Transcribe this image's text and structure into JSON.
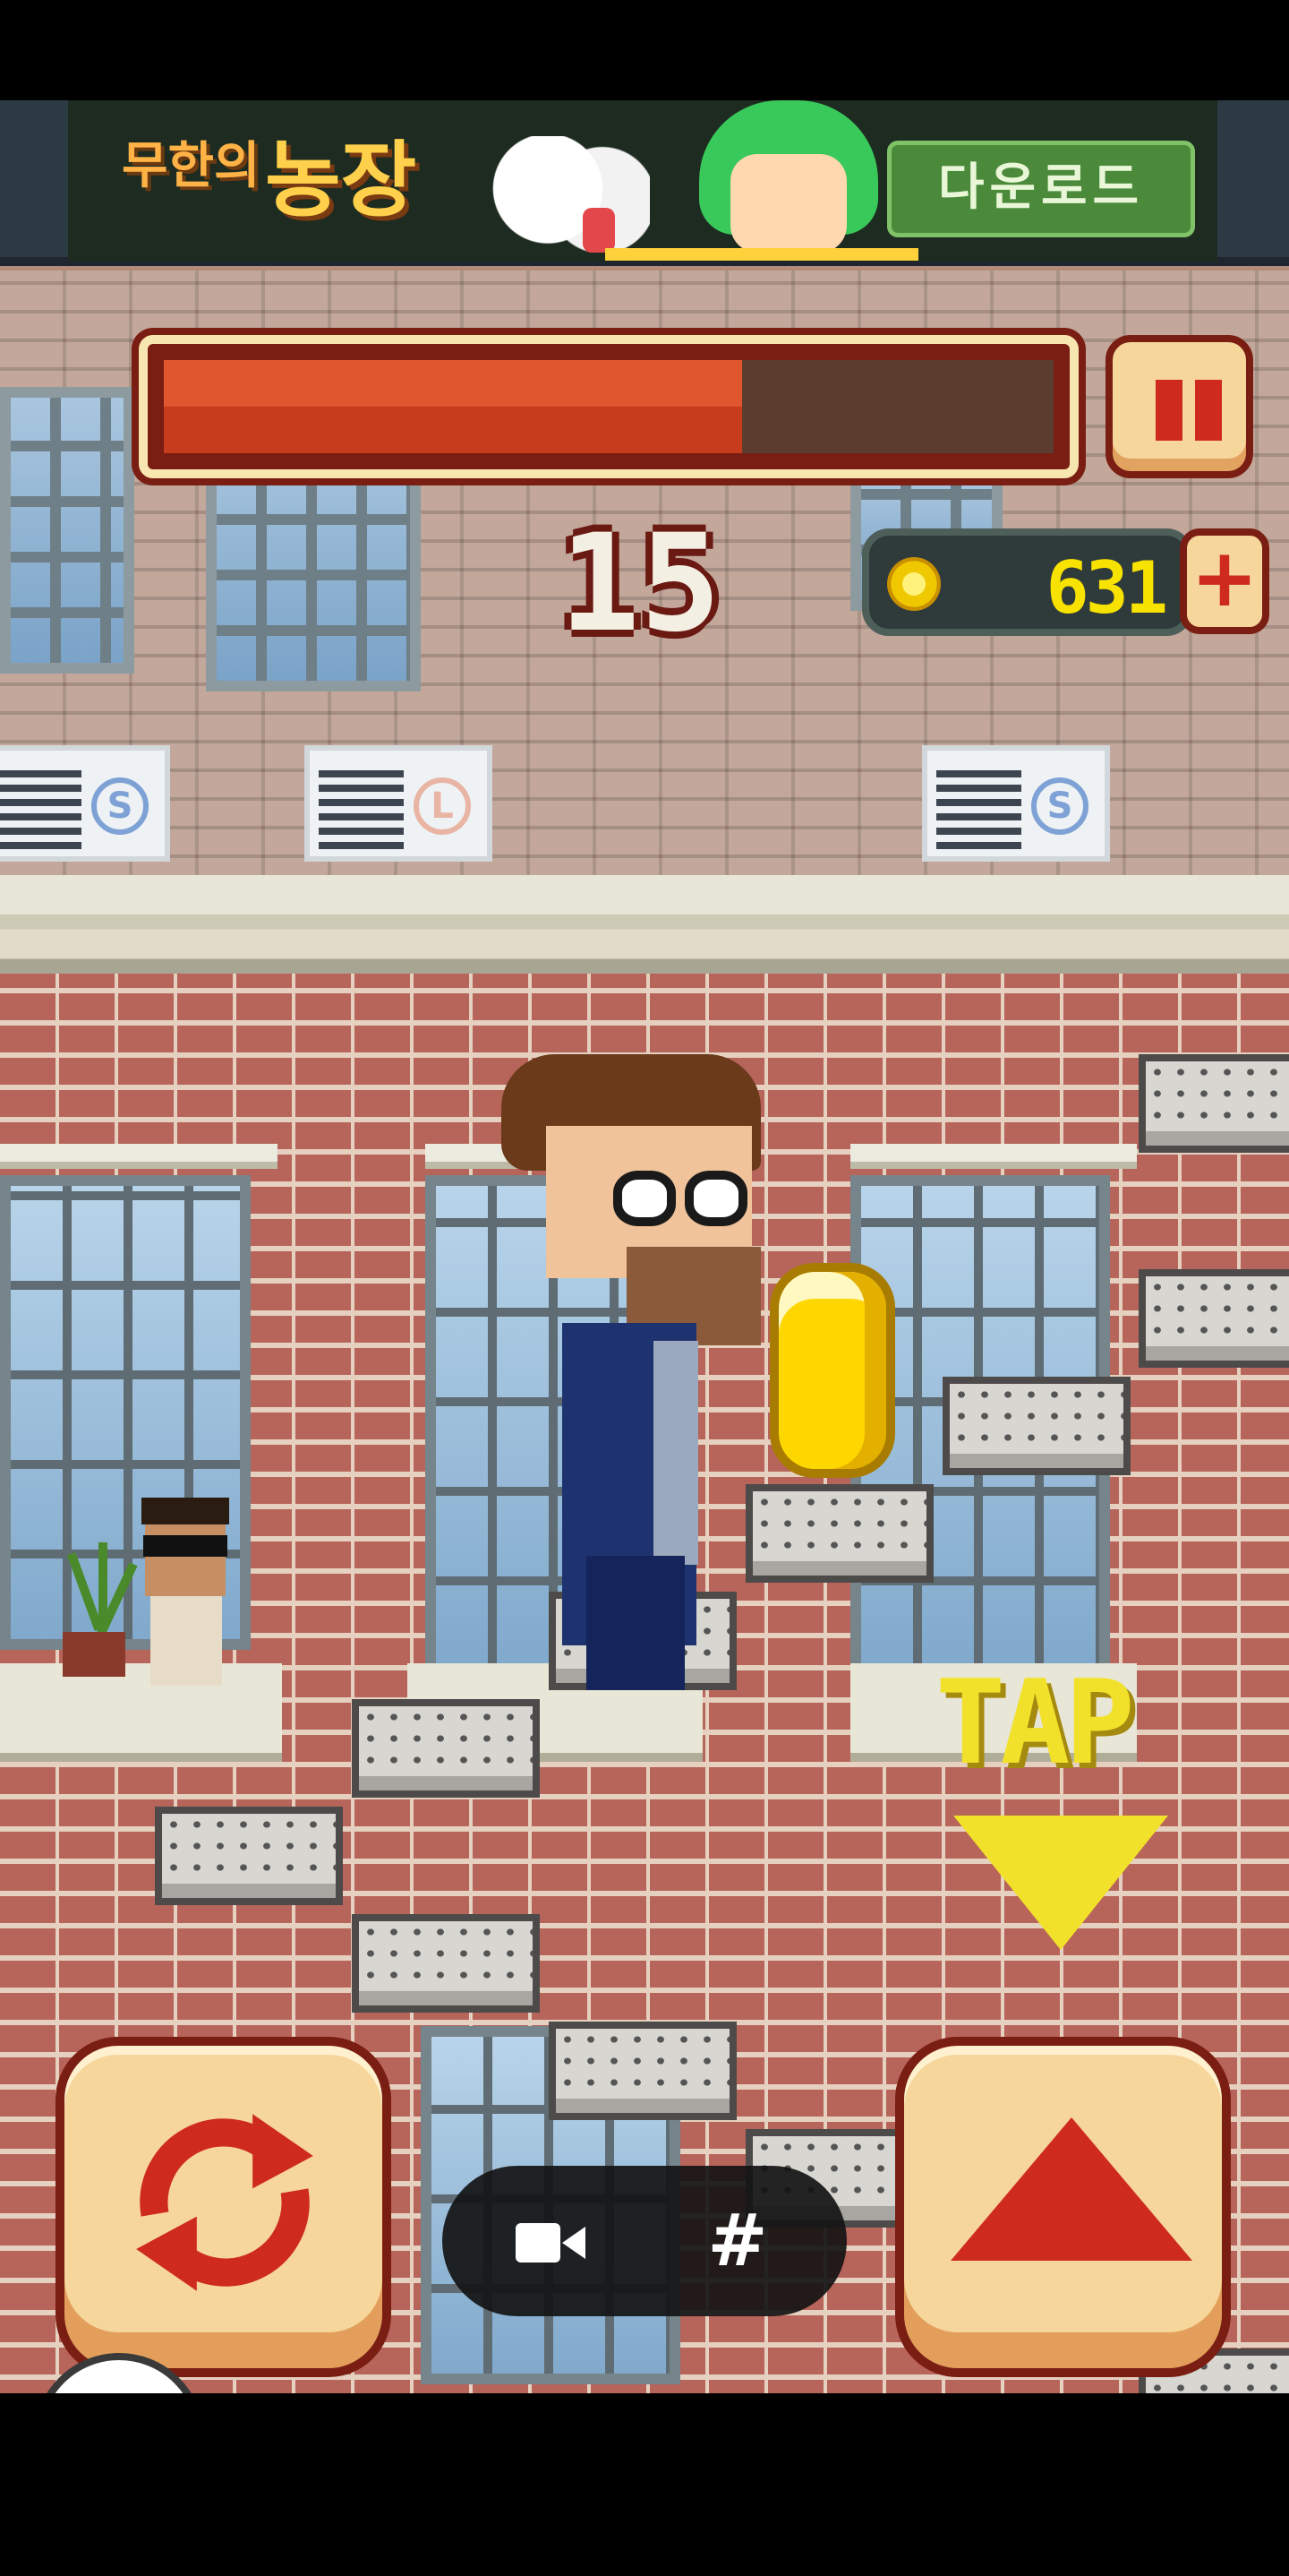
{
  "ad": {
    "title_small": "무한의",
    "title_big": "농장",
    "download_label": "다운로드"
  },
  "hud": {
    "health_fraction": 0.65,
    "score": "15",
    "coins": "631",
    "add_coins_label": "+"
  },
  "hint": {
    "tap_text": "TAP"
  },
  "ac_units": [
    {
      "badge": "S"
    },
    {
      "badge": "L"
    },
    {
      "badge": "S"
    }
  ],
  "toolbar": {
    "hash_label": "#"
  },
  "colors": {
    "health_fill": "#d9492a",
    "coin_text": "#f8e200",
    "button_face": "#f6d69b",
    "button_icon": "#cf2a1e"
  },
  "icons": {
    "pause": "pause-icon",
    "turn": "rotate-arrows-icon",
    "climb": "up-triangle-icon",
    "camera": "video-camera-icon"
  }
}
